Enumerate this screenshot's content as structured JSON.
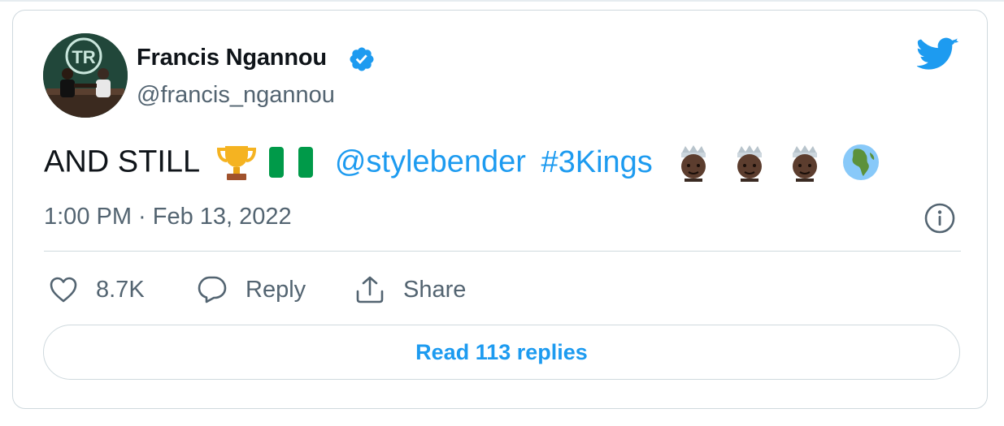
{
  "author": {
    "name": "Francis Ngannou",
    "handle": "@francis_ngannou",
    "verified": true,
    "avatar_logo_text": "TR"
  },
  "tweet": {
    "text_start": "AND STILL",
    "mention": "@stylebender",
    "hashtag": "#3Kings",
    "emojis": [
      "trophy-emoji",
      "nigeria-flag-emoji",
      "prince-emoji",
      "prince-emoji",
      "prince-emoji",
      "globe-africa-emoji"
    ],
    "timestamp": "1:00 PM · Feb 13, 2022"
  },
  "actions": {
    "like_count": "8.7K",
    "reply_label": "Reply",
    "share_label": "Share"
  },
  "read_replies_label": "Read 113 replies",
  "colors": {
    "accent": "#1d9bf0",
    "muted": "#536471",
    "border": "#cfd9de"
  }
}
